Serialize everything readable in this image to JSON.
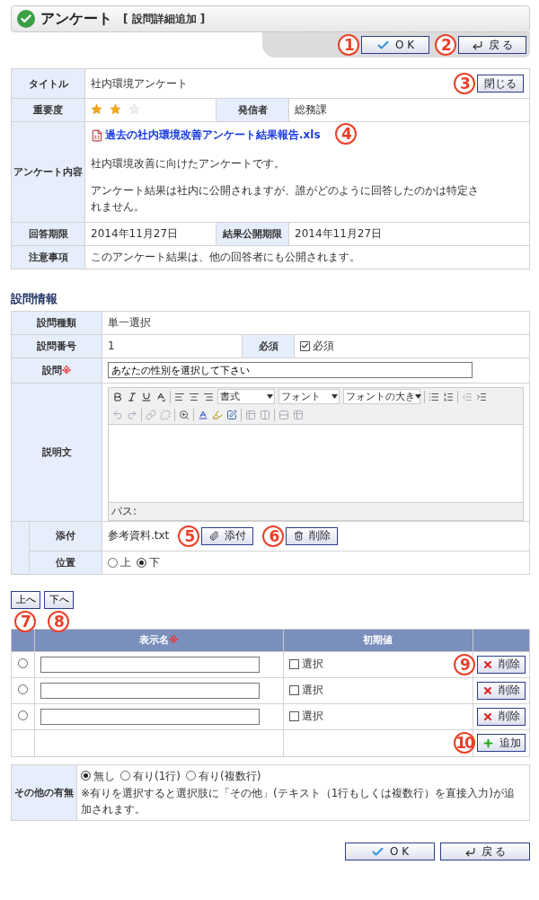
{
  "header": {
    "title": "アンケート",
    "subtitle": "[ 設問詳細追加 ]"
  },
  "top_buttons": [
    {
      "kind": "ok",
      "label": "O K"
    },
    {
      "kind": "back",
      "label": "戻 る"
    }
  ],
  "survey": {
    "title_label": "タイトル",
    "title": "社内環境アンケート",
    "close_button": "閉じる",
    "importance_label": "重要度",
    "stars": 2,
    "sender_label": "発信者",
    "sender": "総務課",
    "content_label": "アンケート内容",
    "attachment": "過去の社内環境改善アンケート結果報告.xls",
    "paragraphs": [
      "社内環境改善に向けたアンケートです。",
      "アンケート結果は社内に公開されますが、誰がどのように回答したのかは特定されません。"
    ],
    "deadline_label": "回答期限",
    "deadline": "2014年11月27日",
    "publish_label": "結果公開期限",
    "publish": "2014年11月27日",
    "notes_label": "注意事項",
    "notes": "このアンケート結果は、他の回答者にも公開されます。"
  },
  "question": {
    "section_title": "設問情報",
    "type_label": "設問種類",
    "type": "単一選択",
    "number_label": "設問番号",
    "number": "1",
    "required_label": "必須",
    "required_checked": true,
    "required_text": "必須",
    "question_label": "設問",
    "required_mark": "※",
    "question_value": "あなたの性別を選択して下さい",
    "description_label": "説明文",
    "editor_dropdowns": [
      "書式",
      "フォント",
      "フォントの大き"
    ],
    "path_label": "パス:",
    "attach_label": "添付",
    "attach_file": "参考資料.txt",
    "attach_button": "添付",
    "delete_button": "削除",
    "position_label": "位置",
    "positions": [
      {
        "label": "上",
        "selected": false
      },
      {
        "label": "下",
        "selected": true
      }
    ]
  },
  "move_buttons": [
    "上へ",
    "下へ"
  ],
  "options": {
    "columns": [
      "表示名",
      "初期値"
    ],
    "required_mark": "※",
    "rows": [
      {
        "selected": false,
        "value": "",
        "checked": false,
        "default_label": "選択",
        "delete_button": "削除"
      },
      {
        "selected": false,
        "value": "",
        "checked": false,
        "default_label": "選択",
        "delete_button": "削除"
      },
      {
        "selected": false,
        "value": "",
        "checked": false,
        "default_label": "選択",
        "delete_button": "削除"
      }
    ],
    "add_button": "追加"
  },
  "other": {
    "label": "その他の有無",
    "choices": [
      {
        "label": "無し",
        "selected": true
      },
      {
        "label": "有り(1行)",
        "selected": false
      },
      {
        "label": "有り(複数行)",
        "selected": false
      }
    ],
    "note": "※有りを選択すると選択肢に「その他」(テキスト（1行もしくは複数行）を直接入力)が追加されます。"
  },
  "bottom_buttons": [
    {
      "kind": "ok",
      "label": "O K"
    },
    {
      "kind": "back",
      "label": "戻 る"
    }
  ],
  "callouts": [
    "1",
    "2",
    "3",
    "4",
    "5",
    "6",
    "7",
    "8",
    "9",
    "10"
  ]
}
